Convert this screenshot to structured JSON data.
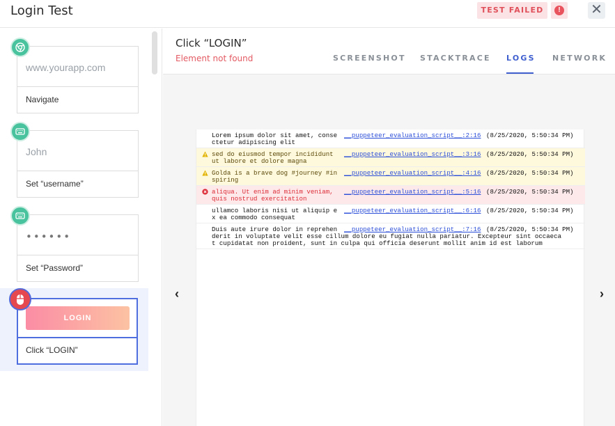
{
  "header": {
    "title": "Login Test",
    "badge": "TEST FAILED",
    "badge_icon": "!",
    "close": "✕"
  },
  "steps": [
    {
      "icon": "chrome-icon",
      "field": "www.yourapp.com",
      "label": "Navigate"
    },
    {
      "icon": "keyboard-icon",
      "field": "John",
      "label": "Set “username”"
    },
    {
      "icon": "keyboard-icon",
      "field": "••••••",
      "label": "Set “Password”"
    },
    {
      "icon": "mouse-icon",
      "button": "LOGIN",
      "label": "Click “LOGIN”"
    }
  ],
  "detail": {
    "title": "Click “LOGIN”",
    "error": "Element not found",
    "tabs": [
      "SCREENSHOT",
      "STACKTRACE",
      "LOGS",
      "NETWORK"
    ],
    "active_tab": "LOGS",
    "prev": "‹",
    "next": "›"
  },
  "logs": [
    {
      "level": "info",
      "msg1": "Lorem ipsum dolor sit amet, conse",
      "msg2": "ctetur adipiscing elit",
      "source": "__puppeteer_evaluation_script__:2:16",
      "time": "(8/25/2020, 5:50:34 PM)"
    },
    {
      "level": "warn",
      "msg1": "sed do eiusmod tempor incididunt",
      "msg2": "ut labore et dolore magna",
      "source": "__puppeteer_evaluation_script__:3:16",
      "time": "(8/25/2020, 5:50:34 PM)"
    },
    {
      "level": "warn",
      "msg1": "Golda is a brave dog #journey #in",
      "msg2": "spiring",
      "source": "__puppeteer_evaluation_script__:4:16",
      "time": "(8/25/2020, 5:50:34 PM)"
    },
    {
      "level": "error",
      "msg1": "aliqua. Ut enim ad minim veniam,",
      "msg2": "quis nostrud exercitation",
      "source": "__puppeteer_evaluation_script__:5:16",
      "time": "(8/25/2020, 5:50:34 PM)"
    },
    {
      "level": "info",
      "msg1": "ullamco laboris nisi ut aliquip e",
      "msg2": "x ea commodo consequat",
      "source": "__puppeteer_evaluation_script__:6:16",
      "time": "(8/25/2020, 5:50:34 PM)"
    },
    {
      "level": "info",
      "msg1": "Duis aute irure dolor in reprehen",
      "msg2": "derit in voluptate velit esse cillum dolore eu fugiat nulla pariatur. Excepteur sint occaeca",
      "msg3": "t cupidatat non proident, sunt in culpa qui officia deserunt mollit anim id est laborum",
      "source": "__puppeteer_evaluation_script__:7:16",
      "time": "(8/25/2020, 5:50:34 PM)"
    }
  ],
  "colors": {
    "accent": "#3f5fcf",
    "error": "#e35a63",
    "success_icon": "#48c39d",
    "badge_bg": "#fbe3e5"
  }
}
